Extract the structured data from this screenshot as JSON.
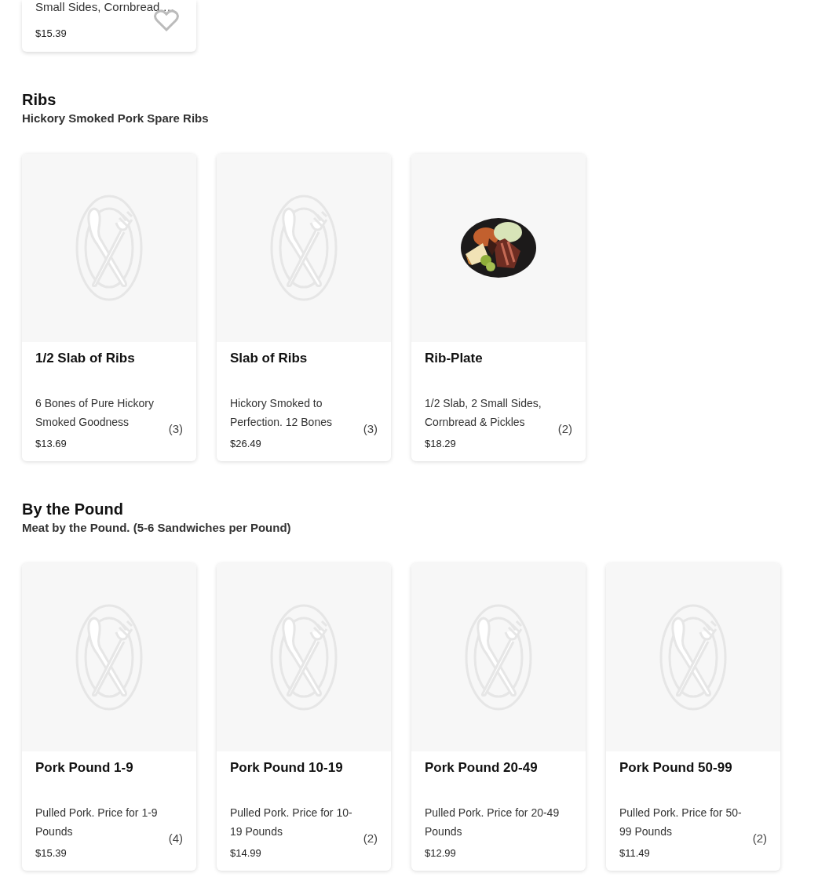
{
  "top_item": {
    "description": "Small Sides, Cornbread …",
    "price": "$15.39",
    "favorite": false
  },
  "sections": [
    {
      "title": "Ribs",
      "subtitle": "Hickory Smoked Pork Spare Ribs",
      "items": [
        {
          "name": "1/2 Slab of Ribs",
          "description": "6 Bones of Pure Hickory Smoked Goodness",
          "price": "$13.69",
          "reviews": "(3)",
          "kind": "placeholder"
        },
        {
          "name": "Slab of Ribs",
          "description": "Hickory Smoked to Perfection. 12 Bones",
          "price": "$26.49",
          "reviews": "(3)",
          "kind": "placeholder"
        },
        {
          "name": "Rib-Plate",
          "description": "1/2 Slab, 2 Small Sides, Cornbread & Pickles",
          "price": "$18.29",
          "reviews": "(2)"
        }
      ]
    },
    {
      "title": "By the Pound",
      "subtitle": "Meat by the Pound. (5-6 Sandwiches per Pound)",
      "items": [
        {
          "name": "Pork Pound 1-9",
          "description": "Pulled Pork. Price for 1-9 Pounds",
          "price": "$15.39",
          "reviews": "(4)",
          "kind": "placeholder"
        },
        {
          "name": "Pork Pound 10-19",
          "description": "Pulled Pork. Price for 10-19 Pounds",
          "price": "$14.99",
          "reviews": "(2)",
          "kind": "placeholder"
        },
        {
          "name": "Pork Pound 20-49",
          "description": "Pulled Pork. Price for 20-49 Pounds",
          "price": "$12.99",
          "kind": "placeholder"
        },
        {
          "name": "Pork Pound 50-99",
          "description": "Pulled Pork. Price for 50-99 Pounds",
          "price": "$11.49",
          "reviews": "(2)",
          "kind": "placeholder"
        }
      ]
    }
  ]
}
